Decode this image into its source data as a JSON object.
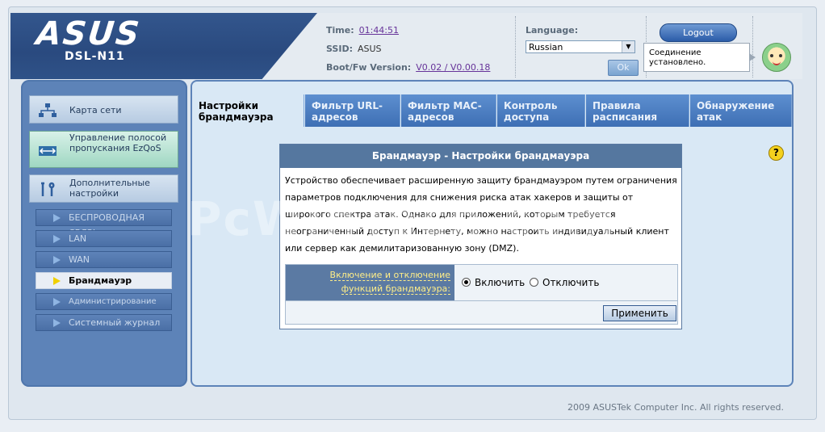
{
  "brand": {
    "logo": "ASUS",
    "model": "DSL-N11"
  },
  "status": {
    "time_label": "Time:",
    "time_value": "01:44:51",
    "ssid_label": "SSID:",
    "ssid_value": "ASUS",
    "fw_label": "Boot/Fw Version:",
    "fw_value": "V0.02 / V0.00.18"
  },
  "language": {
    "label": "Language:",
    "selected": "Russian",
    "ok_label": "Ok"
  },
  "logout_label": "Logout",
  "connection_status": "Соединение установлено.",
  "sidebar": {
    "main_items": [
      {
        "label": "Карта сети",
        "icon": "network-map-icon"
      },
      {
        "label": "Управление полосой пропускания EzQoS",
        "icon": "ezqos-icon"
      },
      {
        "label": "Дополнительные настройки",
        "icon": "tools-icon"
      }
    ],
    "sub_items": [
      {
        "label": "БЕСПРОВОДНАЯ СВЯЗЬ"
      },
      {
        "label": "LAN"
      },
      {
        "label": "WAN"
      },
      {
        "label": "Брандмауэр"
      },
      {
        "label": "Администрирование"
      },
      {
        "label": "Системный журнал"
      }
    ],
    "active_sub_index": 3
  },
  "tabs": [
    {
      "label": "Настройки брандмауэра"
    },
    {
      "label": "Фильтр URL-адресов"
    },
    {
      "label": "Фильтр MAC-адресов"
    },
    {
      "label": "Контроль доступа"
    },
    {
      "label": "Правила расписания"
    },
    {
      "label": "Обнаружение атак"
    }
  ],
  "panel": {
    "title": "Брандмауэр - Настройки брандмауэра",
    "description": "Устройство обеспечивает расширенную защиту брандмауэром путем ограничения параметров подключения для снижения риска атак хакеров и защиты от широкого спектра атак. Однако для приложений, которым требуется неограниченный доступ к Интернету, можно настроить индивидуальный клиент или сервер как демилитаризованную зону (DMZ).",
    "toggle_label": "Включение и отключение функций брандмауэра:",
    "option_on": "Включить",
    "option_off": "Отключить",
    "selected": "on",
    "apply_label": "Применить"
  },
  "watermark": "PcWinTech.com",
  "footer": "2009 ASUSTek Computer Inc. All rights reserved.",
  "colors": {
    "accent": "#2a4a7f",
    "sidebar": "#5d83b8",
    "active_tab_bg": "#d9e8f5",
    "label_text": "#ffee88"
  }
}
